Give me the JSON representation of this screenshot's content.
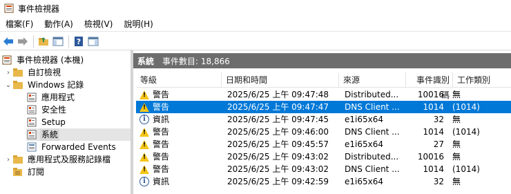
{
  "window": {
    "title": "事件檢視器",
    "app_icon": "event-viewer-icon"
  },
  "menu": [
    {
      "label": "檔案(F)"
    },
    {
      "label": "動作(A)"
    },
    {
      "label": "檢視(V)"
    },
    {
      "label": "說明(H)"
    }
  ],
  "toolbar": {
    "buttons": [
      {
        "name": "back-arrow-icon"
      },
      {
        "name": "forward-arrow-icon"
      },
      {
        "name": "up-folder-icon"
      },
      {
        "name": "show-hide-console-tree-icon"
      },
      {
        "name": "help-icon"
      },
      {
        "name": "show-action-pane-icon"
      }
    ]
  },
  "tree": {
    "items": [
      {
        "label": "事件檢視器 (本機)",
        "chevron": "",
        "icon": "event-viewer-icon"
      },
      {
        "label": "自訂檢視",
        "chevron": "›",
        "icon": "folder-icon"
      },
      {
        "label": "Windows 記錄",
        "chevron": "⌄",
        "icon": "folder-icon"
      },
      {
        "label": "應用程式",
        "chevron": "",
        "icon": "log-icon"
      },
      {
        "label": "安全性",
        "chevron": "",
        "icon": "log-icon"
      },
      {
        "label": "Setup",
        "chevron": "",
        "icon": "log-icon"
      },
      {
        "label": "系統",
        "chevron": "",
        "icon": "log-icon"
      },
      {
        "label": "Forwarded Events",
        "chevron": "",
        "icon": "log-icon"
      },
      {
        "label": "應用程式及服務記錄檔",
        "chevron": "›",
        "icon": "folder-icon"
      },
      {
        "label": "訂閱",
        "chevron": "",
        "icon": "subscription-icon"
      }
    ]
  },
  "log_header": {
    "name": "系統",
    "count_text": "事件數目: 18,866"
  },
  "columns": [
    "等級",
    "日期和時間",
    "來源",
    "事件識別碼",
    "工作類別"
  ],
  "events": [
    {
      "level": "警告",
      "level_icon": "warning-icon",
      "datetime": "2025/6/25 上午 09:47:48",
      "source": "Distributed...",
      "id": "10016",
      "category": "無"
    },
    {
      "level": "警告",
      "level_icon": "warning-icon",
      "datetime": "2025/6/25 上午 09:47:47",
      "source": "DNS Client ...",
      "id": "1014",
      "category": "(1014)"
    },
    {
      "level": "資訊",
      "level_icon": "info-icon",
      "datetime": "2025/6/25 上午 09:47:45",
      "source": "e1i65x64",
      "id": "32",
      "category": "無"
    },
    {
      "level": "警告",
      "level_icon": "warning-icon",
      "datetime": "2025/6/25 上午 09:46:00",
      "source": "DNS Client ...",
      "id": "1014",
      "category": "(1014)"
    },
    {
      "level": "警告",
      "level_icon": "warning-icon",
      "datetime": "2025/6/25 上午 09:45:57",
      "source": "e1i65x64",
      "id": "27",
      "category": "無"
    },
    {
      "level": "警告",
      "level_icon": "warning-icon",
      "datetime": "2025/6/25 上午 09:43:02",
      "source": "Distributed...",
      "id": "10016",
      "category": "無"
    },
    {
      "level": "警告",
      "level_icon": "warning-icon",
      "datetime": "2025/6/25 上午 09:43:02",
      "source": "DNS Client ...",
      "id": "1014",
      "category": "(1014)"
    },
    {
      "level": "資訊",
      "level_icon": "info-icon",
      "datetime": "2025/6/25 上午 09:42:59",
      "source": "e1i65x64",
      "id": "32",
      "category": "無"
    }
  ],
  "colors": {
    "selection": "#0078d7",
    "header_band": "#6d6d6d",
    "warning": "#f5c518",
    "info": "#2b579a"
  }
}
